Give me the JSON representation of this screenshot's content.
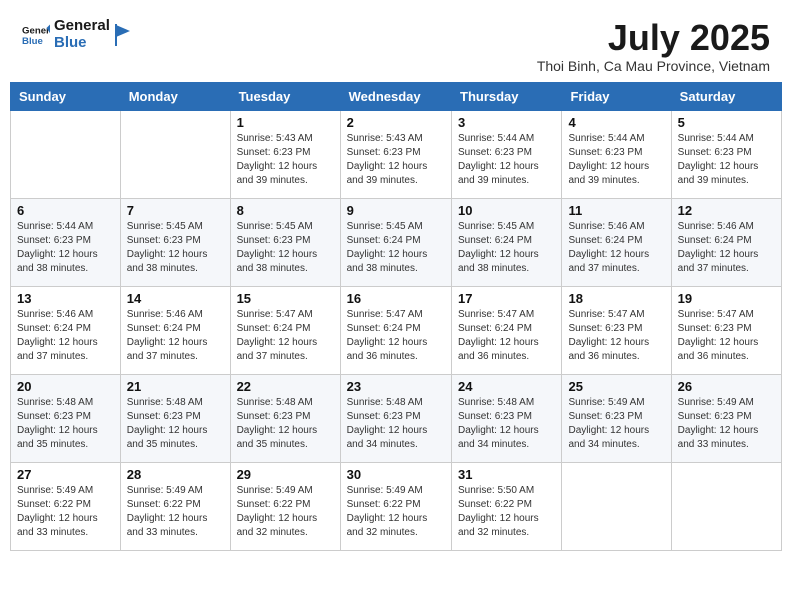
{
  "header": {
    "logo_line1": "General",
    "logo_line2": "Blue",
    "month_title": "July 2025",
    "location": "Thoi Binh, Ca Mau Province, Vietnam"
  },
  "weekdays": [
    "Sunday",
    "Monday",
    "Tuesday",
    "Wednesday",
    "Thursday",
    "Friday",
    "Saturday"
  ],
  "weeks": [
    [
      {
        "day": "",
        "info": ""
      },
      {
        "day": "",
        "info": ""
      },
      {
        "day": "1",
        "info": "Sunrise: 5:43 AM\nSunset: 6:23 PM\nDaylight: 12 hours and 39 minutes."
      },
      {
        "day": "2",
        "info": "Sunrise: 5:43 AM\nSunset: 6:23 PM\nDaylight: 12 hours and 39 minutes."
      },
      {
        "day": "3",
        "info": "Sunrise: 5:44 AM\nSunset: 6:23 PM\nDaylight: 12 hours and 39 minutes."
      },
      {
        "day": "4",
        "info": "Sunrise: 5:44 AM\nSunset: 6:23 PM\nDaylight: 12 hours and 39 minutes."
      },
      {
        "day": "5",
        "info": "Sunrise: 5:44 AM\nSunset: 6:23 PM\nDaylight: 12 hours and 39 minutes."
      }
    ],
    [
      {
        "day": "6",
        "info": "Sunrise: 5:44 AM\nSunset: 6:23 PM\nDaylight: 12 hours and 38 minutes."
      },
      {
        "day": "7",
        "info": "Sunrise: 5:45 AM\nSunset: 6:23 PM\nDaylight: 12 hours and 38 minutes."
      },
      {
        "day": "8",
        "info": "Sunrise: 5:45 AM\nSunset: 6:23 PM\nDaylight: 12 hours and 38 minutes."
      },
      {
        "day": "9",
        "info": "Sunrise: 5:45 AM\nSunset: 6:24 PM\nDaylight: 12 hours and 38 minutes."
      },
      {
        "day": "10",
        "info": "Sunrise: 5:45 AM\nSunset: 6:24 PM\nDaylight: 12 hours and 38 minutes."
      },
      {
        "day": "11",
        "info": "Sunrise: 5:46 AM\nSunset: 6:24 PM\nDaylight: 12 hours and 37 minutes."
      },
      {
        "day": "12",
        "info": "Sunrise: 5:46 AM\nSunset: 6:24 PM\nDaylight: 12 hours and 37 minutes."
      }
    ],
    [
      {
        "day": "13",
        "info": "Sunrise: 5:46 AM\nSunset: 6:24 PM\nDaylight: 12 hours and 37 minutes."
      },
      {
        "day": "14",
        "info": "Sunrise: 5:46 AM\nSunset: 6:24 PM\nDaylight: 12 hours and 37 minutes."
      },
      {
        "day": "15",
        "info": "Sunrise: 5:47 AM\nSunset: 6:24 PM\nDaylight: 12 hours and 37 minutes."
      },
      {
        "day": "16",
        "info": "Sunrise: 5:47 AM\nSunset: 6:24 PM\nDaylight: 12 hours and 36 minutes."
      },
      {
        "day": "17",
        "info": "Sunrise: 5:47 AM\nSunset: 6:24 PM\nDaylight: 12 hours and 36 minutes."
      },
      {
        "day": "18",
        "info": "Sunrise: 5:47 AM\nSunset: 6:23 PM\nDaylight: 12 hours and 36 minutes."
      },
      {
        "day": "19",
        "info": "Sunrise: 5:47 AM\nSunset: 6:23 PM\nDaylight: 12 hours and 36 minutes."
      }
    ],
    [
      {
        "day": "20",
        "info": "Sunrise: 5:48 AM\nSunset: 6:23 PM\nDaylight: 12 hours and 35 minutes."
      },
      {
        "day": "21",
        "info": "Sunrise: 5:48 AM\nSunset: 6:23 PM\nDaylight: 12 hours and 35 minutes."
      },
      {
        "day": "22",
        "info": "Sunrise: 5:48 AM\nSunset: 6:23 PM\nDaylight: 12 hours and 35 minutes."
      },
      {
        "day": "23",
        "info": "Sunrise: 5:48 AM\nSunset: 6:23 PM\nDaylight: 12 hours and 34 minutes."
      },
      {
        "day": "24",
        "info": "Sunrise: 5:48 AM\nSunset: 6:23 PM\nDaylight: 12 hours and 34 minutes."
      },
      {
        "day": "25",
        "info": "Sunrise: 5:49 AM\nSunset: 6:23 PM\nDaylight: 12 hours and 34 minutes."
      },
      {
        "day": "26",
        "info": "Sunrise: 5:49 AM\nSunset: 6:23 PM\nDaylight: 12 hours and 33 minutes."
      }
    ],
    [
      {
        "day": "27",
        "info": "Sunrise: 5:49 AM\nSunset: 6:22 PM\nDaylight: 12 hours and 33 minutes."
      },
      {
        "day": "28",
        "info": "Sunrise: 5:49 AM\nSunset: 6:22 PM\nDaylight: 12 hours and 33 minutes."
      },
      {
        "day": "29",
        "info": "Sunrise: 5:49 AM\nSunset: 6:22 PM\nDaylight: 12 hours and 32 minutes."
      },
      {
        "day": "30",
        "info": "Sunrise: 5:49 AM\nSunset: 6:22 PM\nDaylight: 12 hours and 32 minutes."
      },
      {
        "day": "31",
        "info": "Sunrise: 5:50 AM\nSunset: 6:22 PM\nDaylight: 12 hours and 32 minutes."
      },
      {
        "day": "",
        "info": ""
      },
      {
        "day": "",
        "info": ""
      }
    ]
  ],
  "colors": {
    "header_bg": "#2a6db5",
    "logo_blue": "#2a6db5"
  }
}
